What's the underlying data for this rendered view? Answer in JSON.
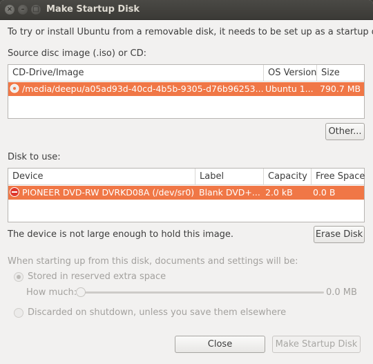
{
  "window": {
    "title": "Make Startup Disk"
  },
  "intro": "To try or install Ubuntu from a removable disk, it needs to be set up as a startup disk.",
  "source": {
    "label": "Source disc image (.iso) or CD:",
    "columns": [
      "CD-Drive/Image",
      "OS Version",
      "Size"
    ],
    "rows": [
      {
        "icon": "disc-icon",
        "image": "/media/deepu/a05ad93d-40cd-4b5b-9305-d76b96253...",
        "os_version": "Ubuntu 1...",
        "size": "790.7 MB"
      }
    ],
    "other_button": "Other..."
  },
  "disk": {
    "label": "Disk to use:",
    "columns": [
      "Device",
      "Label",
      "Capacity",
      "Free Space"
    ],
    "rows": [
      {
        "icon": "no-entry-icon",
        "device": "PIONEER DVD-RW  DVRKD08A (/dev/sr0)",
        "label": "Blank DVD+...",
        "capacity": "2.0 kB",
        "free_space": "0.0 B"
      }
    ],
    "warning": "The device is not large enough to hold this image.",
    "erase_button": "Erase Disk"
  },
  "options": {
    "heading": "When starting up from this disk, documents and settings will be:",
    "stored_label": "Stored in reserved extra space",
    "how_much_label": "How much:",
    "how_much_value": "0.0 MB",
    "discarded_label": "Discarded on shutdown, unless you save them elsewhere"
  },
  "buttons": {
    "close": "Close",
    "make": "Make Startup Disk"
  },
  "colors": {
    "selection": "#f07746",
    "window_bg": "#f2f1f0",
    "titlebar": "#3c3b37"
  }
}
